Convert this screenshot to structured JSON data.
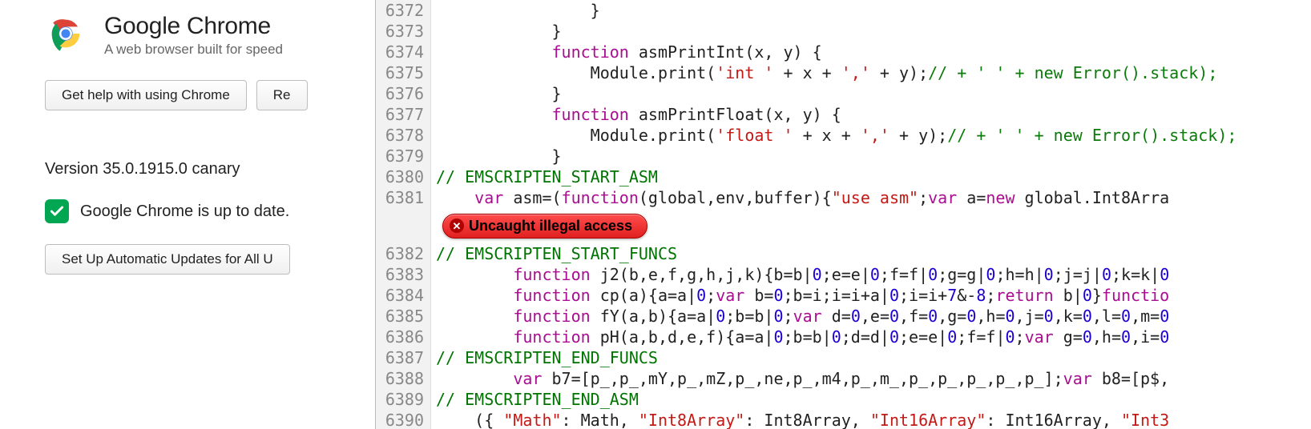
{
  "about": {
    "title": "Google Chrome",
    "subtitle": "A web browser built for speed",
    "help_label": "Get help with using Chrome",
    "second_button_label": "Re",
    "version": "Version 35.0.1915.0 canary",
    "uptodate": "Google Chrome is up to date.",
    "auto_updates_label": "Set Up Automatic Updates for All U"
  },
  "gutter_before_error": [
    "6372",
    "6373",
    "6374",
    "6375",
    "6376",
    "6377",
    "6378",
    "6379",
    "6380",
    "6381"
  ],
  "gutter_after_error": [
    "6382",
    "6383",
    "6384",
    "6385",
    "6386",
    "6387",
    "6388",
    "6389",
    "6390"
  ],
  "code_lines": [
    {
      "indent": "                ",
      "tokens": [
        {
          "t": "}"
        }
      ]
    },
    {
      "indent": "            ",
      "tokens": [
        {
          "t": "}"
        }
      ]
    },
    {
      "indent": "            ",
      "tokens": [
        {
          "t": "function",
          "c": "kw"
        },
        {
          "t": " asmPrintInt(x, y) {"
        }
      ]
    },
    {
      "indent": "                ",
      "tokens": [
        {
          "t": "Module.print("
        },
        {
          "t": "'int '",
          "c": "str"
        },
        {
          "t": " + x + "
        },
        {
          "t": "','",
          "c": "str"
        },
        {
          "t": " + y);"
        },
        {
          "t": "// + ' ' + new Error().stack);",
          "c": "errcmt"
        }
      ]
    },
    {
      "indent": "            ",
      "tokens": [
        {
          "t": "}"
        }
      ]
    },
    {
      "indent": "            ",
      "tokens": [
        {
          "t": "function",
          "c": "kw"
        },
        {
          "t": " asmPrintFloat(x, y) {"
        }
      ]
    },
    {
      "indent": "                ",
      "tokens": [
        {
          "t": "Module.print("
        },
        {
          "t": "'float '",
          "c": "str"
        },
        {
          "t": " + x + "
        },
        {
          "t": "','",
          "c": "str"
        },
        {
          "t": " + y);"
        },
        {
          "t": "// + ' ' + new Error().stack);",
          "c": "errcmt"
        }
      ]
    },
    {
      "indent": "            ",
      "tokens": [
        {
          "t": "}"
        }
      ]
    },
    {
      "indent": "",
      "tokens": [
        {
          "t": "// EMSCRIPTEN_START_ASM",
          "c": "cmt"
        }
      ]
    },
    {
      "indent": "    ",
      "tokens": [
        {
          "t": "var",
          "c": "kw"
        },
        {
          "t": " asm=("
        },
        {
          "t": "function",
          "c": "kw"
        },
        {
          "t": "(global,env,buffer){"
        },
        {
          "t": "\"use asm\"",
          "c": "str"
        },
        {
          "t": ";"
        },
        {
          "t": "var",
          "c": "kw"
        },
        {
          "t": " a="
        },
        {
          "t": "new",
          "c": "kw"
        },
        {
          "t": " global.Int8Arra"
        }
      ]
    }
  ],
  "error_text": "Uncaught illegal access",
  "code_lines_after": [
    {
      "indent": "",
      "tokens": [
        {
          "t": "// EMSCRIPTEN_START_FUNCS",
          "c": "cmt"
        }
      ]
    },
    {
      "indent": "        ",
      "tokens": [
        {
          "t": "function",
          "c": "kw"
        },
        {
          "t": " j2(b,e,f,g,h,j,k){b=b|"
        },
        {
          "t": "0",
          "c": "num"
        },
        {
          "t": ";e=e|"
        },
        {
          "t": "0",
          "c": "num"
        },
        {
          "t": ";f=f|"
        },
        {
          "t": "0",
          "c": "num"
        },
        {
          "t": ";g=g|"
        },
        {
          "t": "0",
          "c": "num"
        },
        {
          "t": ";h=h|"
        },
        {
          "t": "0",
          "c": "num"
        },
        {
          "t": ";j=j|"
        },
        {
          "t": "0",
          "c": "num"
        },
        {
          "t": ";k=k|"
        },
        {
          "t": "0",
          "c": "num"
        }
      ]
    },
    {
      "indent": "        ",
      "tokens": [
        {
          "t": "function",
          "c": "kw"
        },
        {
          "t": " cp(a){a=a|"
        },
        {
          "t": "0",
          "c": "num"
        },
        {
          "t": ";"
        },
        {
          "t": "var",
          "c": "kw"
        },
        {
          "t": " b="
        },
        {
          "t": "0",
          "c": "num"
        },
        {
          "t": ";b=i;i=i+a|"
        },
        {
          "t": "0",
          "c": "num"
        },
        {
          "t": ";i=i+"
        },
        {
          "t": "7",
          "c": "num"
        },
        {
          "t": "&-"
        },
        {
          "t": "8",
          "c": "num"
        },
        {
          "t": ";"
        },
        {
          "t": "return",
          "c": "kw"
        },
        {
          "t": " b|"
        },
        {
          "t": "0",
          "c": "num"
        },
        {
          "t": "}"
        },
        {
          "t": "functio",
          "c": "kw"
        }
      ]
    },
    {
      "indent": "        ",
      "tokens": [
        {
          "t": "function",
          "c": "kw"
        },
        {
          "t": " fY(a,b){a=a|"
        },
        {
          "t": "0",
          "c": "num"
        },
        {
          "t": ";b=b|"
        },
        {
          "t": "0",
          "c": "num"
        },
        {
          "t": ";"
        },
        {
          "t": "var",
          "c": "kw"
        },
        {
          "t": " d="
        },
        {
          "t": "0",
          "c": "num"
        },
        {
          "t": ",e="
        },
        {
          "t": "0",
          "c": "num"
        },
        {
          "t": ",f="
        },
        {
          "t": "0",
          "c": "num"
        },
        {
          "t": ",g="
        },
        {
          "t": "0",
          "c": "num"
        },
        {
          "t": ",h="
        },
        {
          "t": "0",
          "c": "num"
        },
        {
          "t": ",j="
        },
        {
          "t": "0",
          "c": "num"
        },
        {
          "t": ",k="
        },
        {
          "t": "0",
          "c": "num"
        },
        {
          "t": ",l="
        },
        {
          "t": "0",
          "c": "num"
        },
        {
          "t": ",m="
        },
        {
          "t": "0",
          "c": "num"
        }
      ]
    },
    {
      "indent": "        ",
      "tokens": [
        {
          "t": "function",
          "c": "kw"
        },
        {
          "t": " pH(a,b,d,e,f){a=a|"
        },
        {
          "t": "0",
          "c": "num"
        },
        {
          "t": ";b=b|"
        },
        {
          "t": "0",
          "c": "num"
        },
        {
          "t": ";d=d|"
        },
        {
          "t": "0",
          "c": "num"
        },
        {
          "t": ";e=e|"
        },
        {
          "t": "0",
          "c": "num"
        },
        {
          "t": ";f=f|"
        },
        {
          "t": "0",
          "c": "num"
        },
        {
          "t": ";"
        },
        {
          "t": "var",
          "c": "kw"
        },
        {
          "t": " g="
        },
        {
          "t": "0",
          "c": "num"
        },
        {
          "t": ",h="
        },
        {
          "t": "0",
          "c": "num"
        },
        {
          "t": ",i="
        },
        {
          "t": "0",
          "c": "num"
        }
      ]
    },
    {
      "indent": "",
      "tokens": [
        {
          "t": "// EMSCRIPTEN_END_FUNCS",
          "c": "cmt"
        }
      ]
    },
    {
      "indent": "        ",
      "tokens": [
        {
          "t": "var",
          "c": "kw"
        },
        {
          "t": " b7=[p_,p_,mY,p_,mZ,p_,ne,p_,m4,p_,m_,p_,p_,p_,p_,p_];"
        },
        {
          "t": "var",
          "c": "kw"
        },
        {
          "t": " b8=[p$,"
        }
      ]
    },
    {
      "indent": "",
      "tokens": [
        {
          "t": "// EMSCRIPTEN_END_ASM",
          "c": "cmt"
        }
      ]
    },
    {
      "indent": "    ",
      "tokens": [
        {
          "t": "({ "
        },
        {
          "t": "\"Math\"",
          "c": "str"
        },
        {
          "t": ": Math, "
        },
        {
          "t": "\"Int8Array\"",
          "c": "str"
        },
        {
          "t": ": Int8Array, "
        },
        {
          "t": "\"Int16Array\"",
          "c": "str"
        },
        {
          "t": ": Int16Array, "
        },
        {
          "t": "\"Int3",
          "c": "str"
        }
      ]
    }
  ]
}
